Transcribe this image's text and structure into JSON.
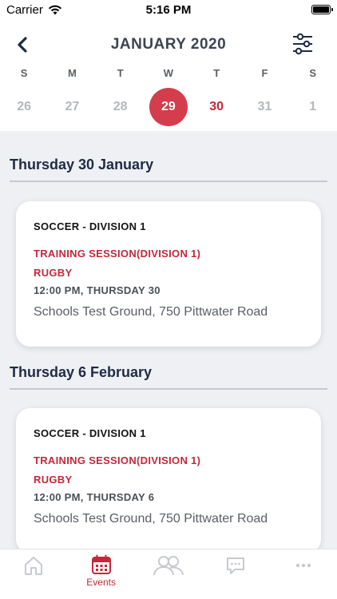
{
  "status_bar": {
    "carrier": "Carrier",
    "time": "5:16 PM"
  },
  "calendar": {
    "month_title": "JANUARY 2020",
    "days_of_week": [
      "S",
      "M",
      "T",
      "W",
      "T",
      "F",
      "S"
    ],
    "dates": [
      "26",
      "27",
      "28",
      "29",
      "30",
      "31",
      "1"
    ],
    "selected_date": "29",
    "event_date": "30"
  },
  "event_groups": [
    {
      "heading": "Thursday 30 January",
      "event": {
        "team": "SOCCER - DIVISION 1",
        "session": "TRAINING SESSION(DIVISION 1)",
        "sport": "RUGBY",
        "time": "12:00 PM, THURSDAY 30",
        "location": "Schools Test Ground, 750 Pittwater Road"
      }
    },
    {
      "heading": "Thursday 6 February",
      "event": {
        "team": "SOCCER - DIVISION 1",
        "session": "TRAINING SESSION(DIVISION 1)",
        "sport": "RUGBY",
        "time": "12:00 PM, THURSDAY 6",
        "location": "Schools Test Ground, 750 Pittwater Road"
      }
    }
  ],
  "tab_bar": {
    "tabs": [
      {
        "icon": "home-icon",
        "label": ""
      },
      {
        "icon": "calendar-icon",
        "label": "Events"
      },
      {
        "icon": "people-icon",
        "label": ""
      },
      {
        "icon": "chat-icon",
        "label": ""
      },
      {
        "icon": "more-icon",
        "label": ""
      }
    ],
    "active_index": 1
  },
  "colors": {
    "accent": "#c3283a",
    "selected_circle": "#d43d4b",
    "heading_navy": "#1f2a44",
    "background": "#eef0f4"
  }
}
